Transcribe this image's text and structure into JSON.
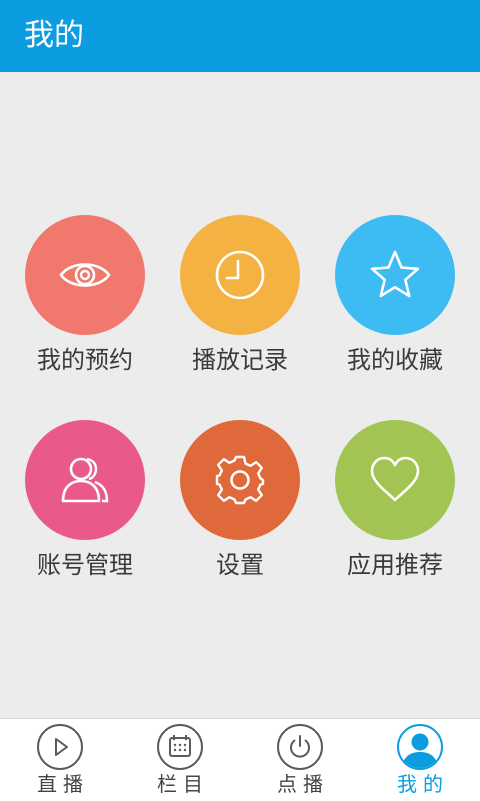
{
  "header": {
    "title": "我的"
  },
  "grid": {
    "items": [
      {
        "label": "我的预约",
        "icon": "eye-icon",
        "color": "#f0786c"
      },
      {
        "label": "播放记录",
        "icon": "clock-icon",
        "color": "#f4b243"
      },
      {
        "label": "我的收藏",
        "icon": "star-icon",
        "color": "#3dbbf3"
      },
      {
        "label": "账号管理",
        "icon": "user-icon",
        "color": "#ea5a88"
      },
      {
        "label": "设置",
        "icon": "gear-icon",
        "color": "#e0693b"
      },
      {
        "label": "应用推荐",
        "icon": "heart-icon",
        "color": "#a2c453"
      }
    ]
  },
  "tabs": [
    {
      "label": "直播",
      "icon": "play-icon",
      "active": false
    },
    {
      "label": "栏目",
      "icon": "calendar-icon",
      "active": false
    },
    {
      "label": "点播",
      "icon": "power-icon",
      "active": false
    },
    {
      "label": "我的",
      "icon": "profile-icon",
      "active": true
    }
  ],
  "colors": {
    "accent": "#0b9de0",
    "background": "#ececec"
  }
}
